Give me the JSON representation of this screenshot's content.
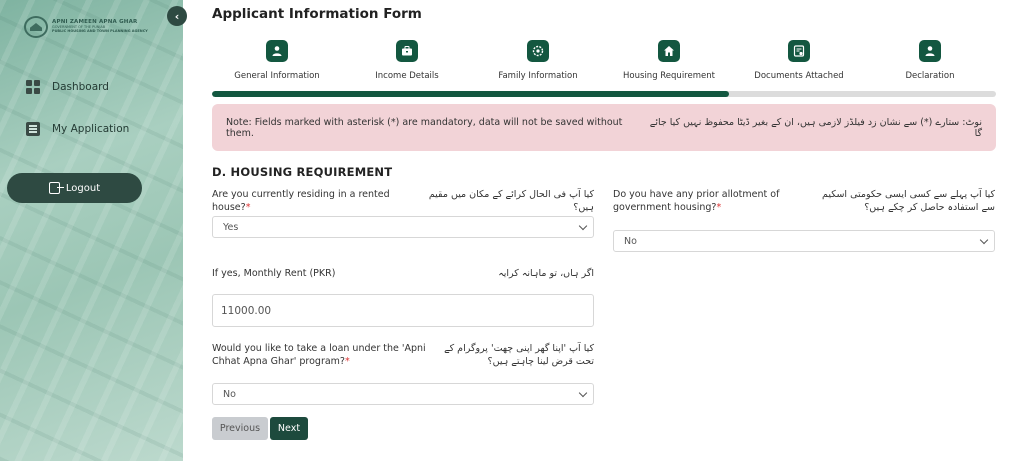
{
  "sidebar": {
    "logo": {
      "line1": "APNI ZAMEEN APNA GHAR",
      "line2": "GOVERNMENT OF THE PUNJAB",
      "line3": "PUBLIC HOUSING AND TOWN PLANNING AGENCY"
    },
    "items": [
      {
        "label": "Dashboard",
        "icon": "dashboard-icon"
      },
      {
        "label": "My Application",
        "icon": "application-icon"
      }
    ],
    "logout_label": "Logout"
  },
  "page": {
    "title": "Applicant Information Form"
  },
  "steps": [
    {
      "label": "General Information",
      "icon": "user-icon"
    },
    {
      "label": "Income Details",
      "icon": "briefcase-icon"
    },
    {
      "label": "Family Information",
      "icon": "family-icon"
    },
    {
      "label": "Housing Requirement",
      "icon": "home-icon"
    },
    {
      "label": "Documents Attached",
      "icon": "document-icon"
    },
    {
      "label": "Declaration",
      "icon": "user-icon"
    }
  ],
  "progress": {
    "percent": 66
  },
  "note": {
    "en": "Note: Fields marked with asterisk (*) are mandatory, data will not be saved without them.",
    "ur": "نوٹ: ستارے (*) سے نشان زد فیلڈز لازمی ہیں، ان کے بغیر ڈیٹا محفوظ نہیں کیا جائے گا"
  },
  "section": {
    "title": "D. HOUSING REQUIREMENT"
  },
  "fields": {
    "rented": {
      "label_en": "Are you currently residing in a rented house?",
      "required": "*",
      "label_ur": "کیا آپ فی الحال کرائے کے مکان میں مقیم ہیں؟",
      "value": "Yes"
    },
    "prior_allotment": {
      "label_en": "Do you have any prior allotment of government housing?",
      "required": "*",
      "label_ur": "کیا آپ پہلے سے کسی ایسی حکومتی اسکیم سے استفادہ حاصل کر چکے ہیں؟",
      "value": "No"
    },
    "rent": {
      "label_en": "If yes, Monthly Rent (PKR)",
      "label_ur": "اگر ہاں، تو ماہانہ کرایہ",
      "value": "11000.00"
    },
    "loan": {
      "label_en": "Would you like to take a loan under the 'Apni Chhat Apna Ghar' program?",
      "required": "*",
      "label_ur": "کیا آپ 'اپنا گھر اپنی چھت' پروگرام کے تحت قرض لینا چاہتے ہیں؟",
      "value": "No"
    }
  },
  "buttons": {
    "previous": "Previous",
    "next": "Next"
  },
  "colors": {
    "primary": "#135740",
    "note_bg": "#f2d3d7",
    "required": "#dd3333"
  }
}
